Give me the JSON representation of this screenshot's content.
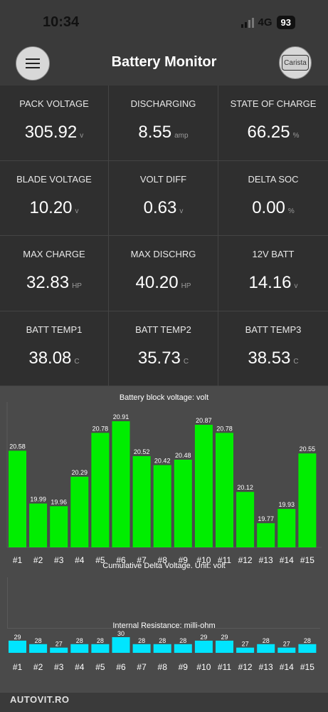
{
  "status_bar": {
    "time": "10:34",
    "network": "4G",
    "battery": "93"
  },
  "header": {
    "title": "Battery Monitor",
    "carista_label": "Carista"
  },
  "metrics": [
    {
      "label": "PACK VOLTAGE",
      "value": "305.92",
      "unit": "v"
    },
    {
      "label": "DISCHARGING",
      "value": "8.55",
      "unit": "amp"
    },
    {
      "label": "STATE OF CHARGE",
      "value": "66.25",
      "unit": "%"
    },
    {
      "label": "BLADE VOLTAGE",
      "value": "10.20",
      "unit": "v"
    },
    {
      "label": "VOLT DIFF",
      "value": "0.63",
      "unit": "v"
    },
    {
      "label": "DELTA SOC",
      "value": "0.00",
      "unit": "%"
    },
    {
      "label": "MAX CHARGE",
      "value": "32.83",
      "unit": "HP"
    },
    {
      "label": "MAX DISCHRG",
      "value": "40.20",
      "unit": "HP"
    },
    {
      "label": "12V BATT",
      "value": "14.16",
      "unit": "v"
    },
    {
      "label": "BATT TEMP1",
      "value": "38.08",
      "unit": "C"
    },
    {
      "label": "BATT TEMP2",
      "value": "35.73",
      "unit": "C"
    },
    {
      "label": "BATT TEMP3",
      "value": "38.53",
      "unit": "C"
    }
  ],
  "chart_data": [
    {
      "type": "bar",
      "title": "Battery block voltage: volt",
      "categories": [
        "#1",
        "#2",
        "#3",
        "#4",
        "#5",
        "#6",
        "#7",
        "#8",
        "#9",
        "#10",
        "#11",
        "#12",
        "#13",
        "#14",
        "#15"
      ],
      "values": [
        20.58,
        19.99,
        19.96,
        20.29,
        20.78,
        20.91,
        20.52,
        20.42,
        20.48,
        20.87,
        20.78,
        20.12,
        19.77,
        19.93,
        20.55
      ],
      "value_labels": [
        "20.58",
        "19.99",
        "19.96",
        "20.29",
        "20.78",
        "20.91",
        "20.52",
        "20.42",
        "20.48",
        "20.87",
        "20.78",
        "20.12",
        "19.77",
        "19.93",
        "20.55"
      ],
      "ylim": [
        19.5,
        20.95
      ],
      "color": "#00ee00"
    },
    {
      "type": "line",
      "title": "Cumulative Delta Voltage. Unit: volt",
      "series": []
    },
    {
      "type": "bar",
      "title": "Internal Resistance: milli-ohm",
      "categories": [
        "#1",
        "#2",
        "#3",
        "#4",
        "#5",
        "#6",
        "#7",
        "#8",
        "#9",
        "#10",
        "#11",
        "#12",
        "#13",
        "#14",
        "#15"
      ],
      "values": [
        29,
        28,
        27,
        28,
        28,
        30,
        28,
        28,
        28,
        29,
        29,
        27,
        28,
        27,
        28
      ],
      "ylim": [
        25.5,
        30
      ],
      "color": "#00e5ff"
    }
  ],
  "watermark": "AUTOVIT.RO"
}
